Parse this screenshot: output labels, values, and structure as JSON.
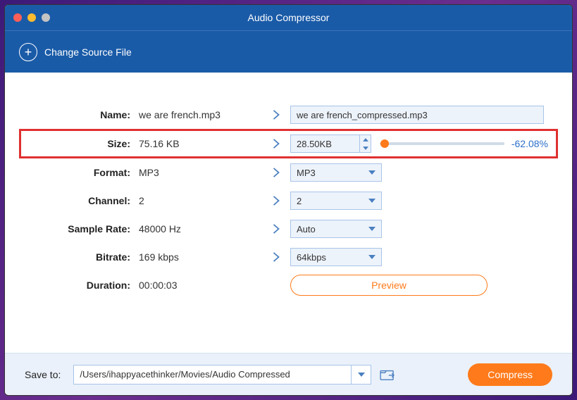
{
  "window": {
    "title": "Audio Compressor"
  },
  "toolbar": {
    "change_source": "Change Source File"
  },
  "labels": {
    "name": "Name:",
    "size": "Size:",
    "format": "Format:",
    "channel": "Channel:",
    "sample_rate": "Sample Rate:",
    "bitrate": "Bitrate:",
    "duration": "Duration:"
  },
  "source": {
    "name": "we are french.mp3",
    "size": "75.16 KB",
    "format": "MP3",
    "channel": "2",
    "sample_rate": "48000 Hz",
    "bitrate": "169 kbps",
    "duration": "00:00:03"
  },
  "target": {
    "name": "we are french_compressed.mp3",
    "size": "28.50KB",
    "size_pct": "-62.08%",
    "format": "MP3",
    "channel": "2",
    "sample_rate": "Auto",
    "bitrate": "64kbps"
  },
  "preview": "Preview",
  "footer": {
    "save_to": "Save to:",
    "path": "/Users/ihappyacethinker/Movies/Audio Compressed",
    "compress": "Compress"
  }
}
